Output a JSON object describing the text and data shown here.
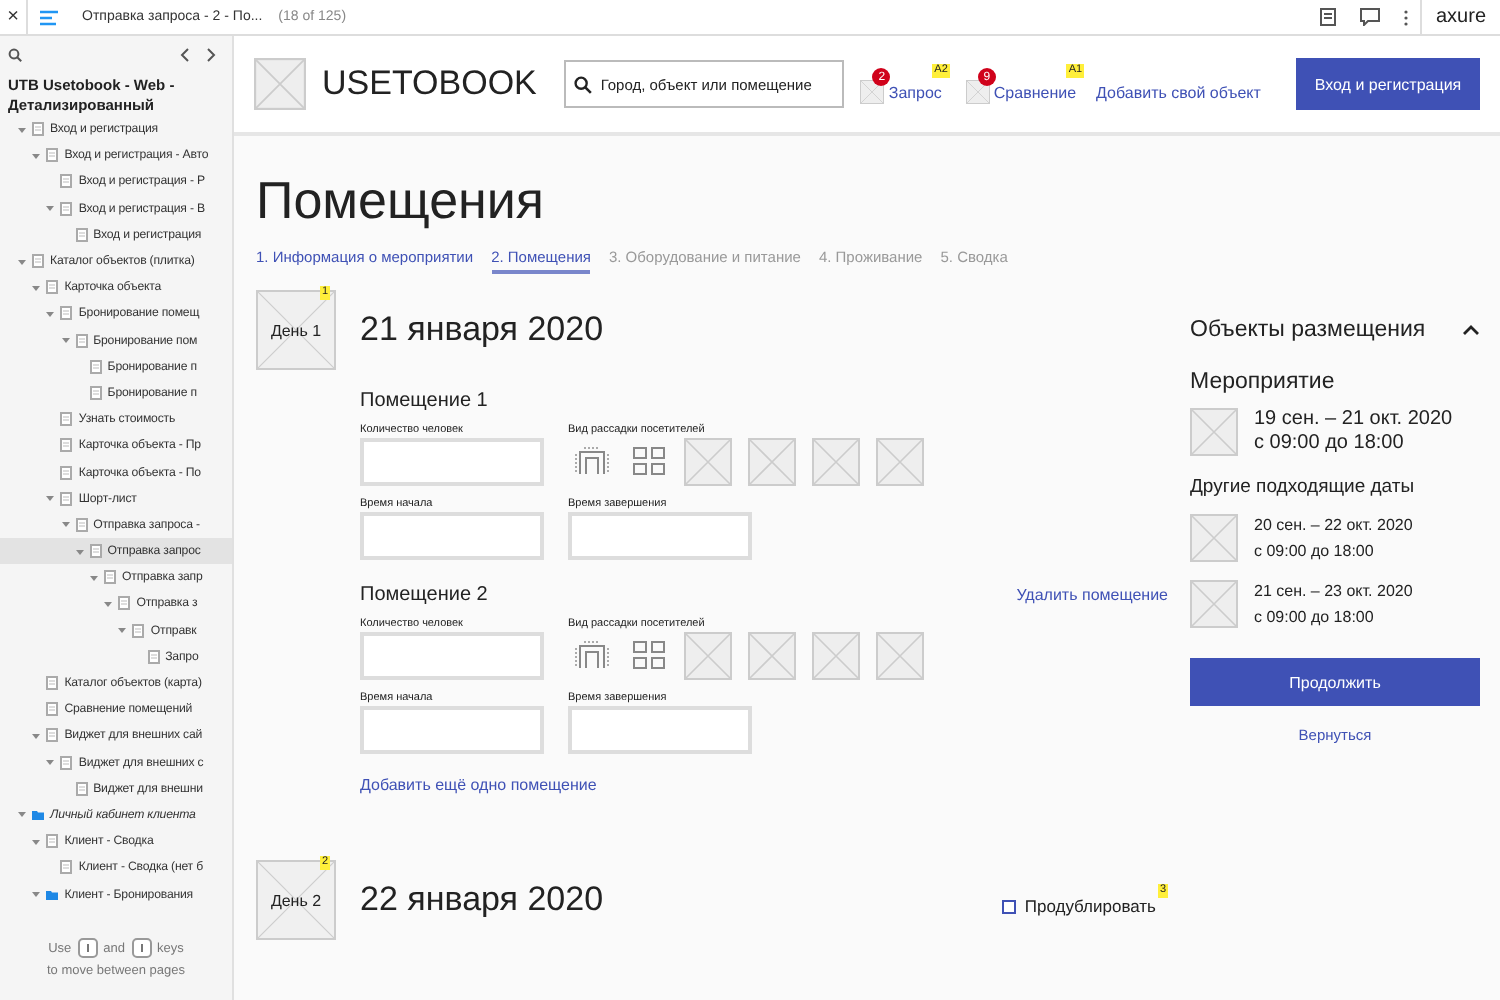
{
  "player": {
    "close": "×",
    "page_title": "Отправка запроса - 2 - По...",
    "page_count": "(18 of 125)",
    "brand": "axure"
  },
  "sidebar": {
    "project_title": "UTB Usetobook - Web - Детализированный",
    "footer_use": "Use",
    "footer_and": "and",
    "footer_keys": "keys",
    "footer_hint": "to move between pages",
    "items": [
      {
        "label": "Вход и регистрация",
        "kind": "page",
        "expanded": true,
        "selected": false,
        "children": [
          {
            "label": "Вход и регистрация - Авто",
            "kind": "page",
            "expanded": true,
            "selected": false,
            "children": [
              {
                "label": "Вход и регистрация - Р",
                "kind": "page",
                "selected": false
              },
              {
                "label": "Вход и регистрация - В",
                "kind": "page",
                "expanded": true,
                "selected": false,
                "children": [
                  {
                    "label": "Вход и регистрация",
                    "kind": "page",
                    "selected": false
                  }
                ]
              }
            ]
          }
        ]
      },
      {
        "label": "Каталог объектов (плитка)",
        "kind": "page",
        "expanded": true,
        "selected": false,
        "children": [
          {
            "label": "Карточка объекта",
            "kind": "page",
            "expanded": true,
            "selected": false,
            "children": [
              {
                "label": "Бронирование помещ",
                "kind": "page",
                "expanded": true,
                "selected": false,
                "children": [
                  {
                    "label": "Бронирование пом",
                    "kind": "page",
                    "expanded": true,
                    "selected": false,
                    "children": [
                      {
                        "label": "Бронирование п",
                        "kind": "page",
                        "selected": false
                      },
                      {
                        "label": "Бронирование п",
                        "kind": "page",
                        "selected": false
                      }
                    ]
                  }
                ]
              },
              {
                "label": "Узнать стоимость",
                "kind": "page",
                "selected": false
              },
              {
                "label": "Карточка объекта - Пр",
                "kind": "page",
                "selected": false
              },
              {
                "label": "Карточка объекта - По",
                "kind": "page",
                "selected": false
              },
              {
                "label": "Шорт-лист",
                "kind": "page",
                "expanded": true,
                "selected": false,
                "children": [
                  {
                    "label": "Отправка запроса -",
                    "kind": "page",
                    "expanded": true,
                    "selected": false,
                    "children": [
                      {
                        "label": "Отправка запрос",
                        "kind": "page",
                        "expanded": true,
                        "selected": true,
                        "children": [
                          {
                            "label": "Отправка запр",
                            "kind": "page",
                            "expanded": true,
                            "selected": false,
                            "children": [
                              {
                                "label": "Отправка з",
                                "kind": "page",
                                "expanded": true,
                                "selected": false,
                                "children": [
                                  {
                                    "label": "Отправк",
                                    "kind": "page",
                                    "expanded": true,
                                    "selected": false,
                                    "children": [
                                      {
                                        "label": "Запро",
                                        "kind": "page",
                                        "selected": false
                                      }
                                    ]
                                  }
                                ]
                              }
                            ]
                          }
                        ]
                      }
                    ]
                  }
                ]
              }
            ]
          },
          {
            "label": "Каталог объектов (карта)",
            "kind": "page",
            "selected": false
          },
          {
            "label": "Сравнение помещений",
            "kind": "page",
            "selected": false
          },
          {
            "label": "Виджет для внешних сай",
            "kind": "page",
            "expanded": true,
            "selected": false,
            "children": [
              {
                "label": "Виджет для внешних с",
                "kind": "page",
                "expanded": true,
                "selected": false,
                "children": [
                  {
                    "label": "Виджет для внешни",
                    "kind": "page",
                    "selected": false
                  }
                ]
              }
            ]
          }
        ]
      },
      {
        "label": "Личный кабинет клиента",
        "kind": "folder",
        "expanded": true,
        "selected": false,
        "children": [
          {
            "label": "Клиент - Сводка",
            "kind": "page",
            "expanded": true,
            "selected": false,
            "children": [
              {
                "label": "Клиент - Сводка (нет б",
                "kind": "page",
                "selected": false
              }
            ]
          },
          {
            "label": "Клиент - Бронирования",
            "kind": "folder",
            "expanded": true,
            "selected": false
          }
        ]
      }
    ]
  },
  "header": {
    "logo": "USETOBOOK",
    "search": {
      "placeholder": "Город, объект или помещение"
    },
    "nav": [
      {
        "label": "Запрос",
        "count": "2",
        "note": "A2"
      },
      {
        "label": "Сравнение",
        "count": "9",
        "note": "A1"
      }
    ],
    "add_link": "Добавить свой объект",
    "login_button": "Вход и регистрация"
  },
  "page_title": "Помещения",
  "steps": [
    {
      "label": "1. Информация о мероприятии",
      "done": true,
      "selected": false
    },
    {
      "label": "2. Помещения",
      "done": true,
      "selected": true
    },
    {
      "label": "3. Оборудование и питание",
      "done": false,
      "selected": false
    },
    {
      "label": "4. Проживание",
      "done": false,
      "selected": false
    },
    {
      "label": "5. Сводка",
      "done": false,
      "selected": false
    }
  ],
  "days": [
    {
      "badge": "День 1",
      "note": "1",
      "date": "21 января 2020",
      "rooms": [
        {
          "title": "Помещение 1",
          "people_label": "Количество человек",
          "seating_label": "Вид рассадки посетителей",
          "start_label": "Время начала",
          "end_label": "Время завершения"
        },
        {
          "title": "Помещение 2",
          "remove_link": "Удалить помещение",
          "people_label": "Количество человек",
          "seating_label": "Вид рассадки посетителей",
          "start_label": "Время начала",
          "end_label": "Время завершения"
        }
      ],
      "add_room": "Добавить ещё одно помещение"
    },
    {
      "badge": "День 2",
      "note": "2",
      "date": "22 января 2020",
      "duplicate": {
        "label": "Продублировать",
        "checked": false,
        "note": "3"
      }
    }
  ],
  "summary": {
    "title": "Объекты размещения",
    "expanded": true,
    "event_heading": "Мероприятие",
    "event": {
      "dates": "19 сен. – 21 окт. 2020",
      "time": "с 09:00 до 18:00"
    },
    "other_heading": "Другие подходящие даты",
    "other": [
      {
        "dates": "20 сен. – 22 окт. 2020",
        "time": "с 09:00 до 18:00"
      },
      {
        "dates": "21 сен. – 23 окт. 2020",
        "time": "с 09:00 до 18:00"
      }
    ],
    "continue_button": "Продолжить",
    "back_link": "Вернуться"
  }
}
